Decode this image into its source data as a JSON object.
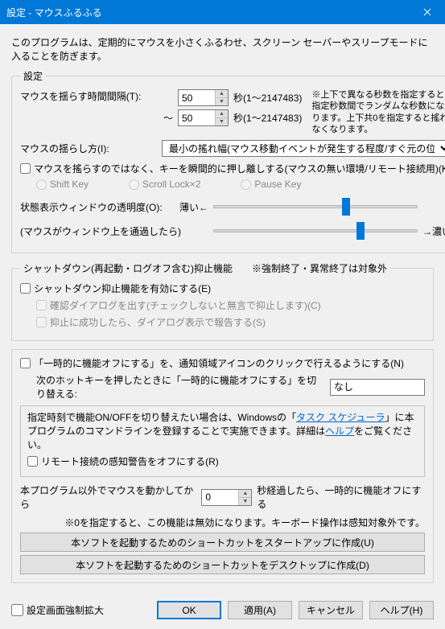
{
  "window": {
    "title": "設定 - マウスふるふる"
  },
  "desc": "このプログラムは、定期的にマウスを小さくふるわせ、スクリーン セーバーやスリープモードに入ることを防ぎます。",
  "settings": {
    "legend": "設定",
    "interval_label": "マウスを揺らす時間間隔(T):",
    "interval_from": "50",
    "interval_to_prefix": "～",
    "interval_to": "50",
    "interval_unit": "秒(1～2147483)",
    "interval_note": "※上下で異なる秒数を指定すると指定秒数間でランダムな秒数になります。上下共0を指定すると搖れなくなります。",
    "shake_method_label": "マウスの揺らし方(I):",
    "shake_method_value": "最小の搖れ幅(マウス移動イベントが発生する程度/すぐ元の位置に戻す)",
    "key_insteadof": "マウスを搖らすのではなく、キーを瞬間的に押し離しする(マウスの無い環境/リモート接続用)(K)",
    "radio_shift": "Shift Key",
    "radio_scroll": "Scroll Lock×2",
    "radio_pause": "Pause Key",
    "opacity_label": "状態表示ウィンドウの透明度(O):",
    "opacity_sub": "(マウスがウィンドウ上を通過したら)",
    "thin": "薄い←",
    "thick": "→濃い"
  },
  "shutdown": {
    "legend": "シャットダウン(再起動・ログオフ含む)抑止機能　　※強制終了・異常終了は対象外",
    "enable": "シャットダウン抑止機能を有効にする(E)",
    "confirm": "確認ダイアログを出す(チェックしないと無言で抑止します)(C)",
    "report": "抑止に成功したら、ダイアログ表示で報告する(S)"
  },
  "tempoff": {
    "toggle_tray": "「一時的に機能オフにする」を、通知領域アイコンのクリックで行えるようにする(N)",
    "hotkey_label": "次のホットキーを押したときに「一時的に機能オフにする」を切り替える:",
    "hotkey_value": "なし",
    "info_before": "指定時刻で機能ON/OFFを切り替えたい場合は、Windowsの「",
    "info_link1": "タスク スケジューラ",
    "info_mid": "」に本プログラムのコマンドラインを登録することで実施できます。詳細は",
    "info_link2": "ヘルプ",
    "info_after": "をご覧ください。",
    "remote_warn": "リモート接続の感知警告をオフにする(R)",
    "other_mouse_label_before": "本プログラム以外でマウスを動かしてから",
    "other_mouse_value": "0",
    "other_mouse_label_after": "秒経過したら、一時的に機能オフにする",
    "other_mouse_note": "※0を指定すると、この機能は無効になります。キーボード操作は感知対象外です。",
    "btn_startup": "本ソフトを起動するためのショートカットをスタートアップに作成(U)",
    "btn_desktop": "本ソフトを起動するためのショートカットをデスクトップに作成(D)"
  },
  "footer": {
    "force_expand": "設定画面強制拡大",
    "ok": "OK",
    "apply": "適用(A)",
    "cancel": "キャンセル",
    "help": "ヘルプ(H)"
  }
}
